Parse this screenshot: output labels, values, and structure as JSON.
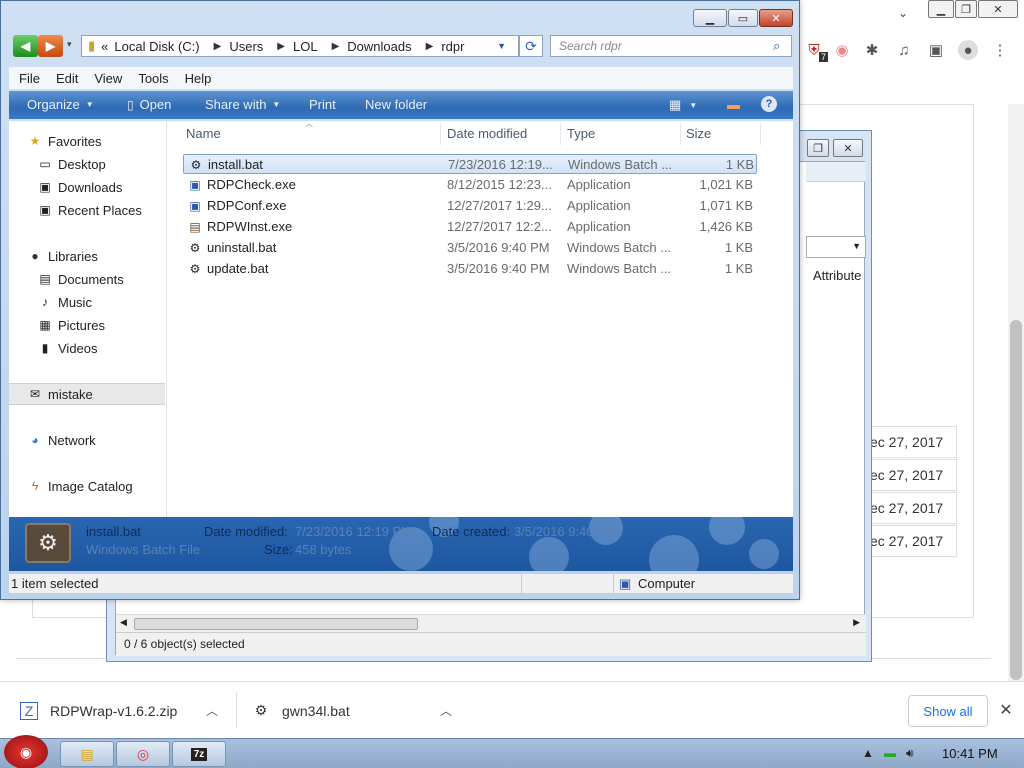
{
  "explorer": {
    "address": {
      "parts": [
        "Local Disk (C:)",
        "Users",
        "LOL",
        "Downloads",
        "rdpr"
      ],
      "overflow": "«"
    },
    "search_placeholder": "Search rdpr",
    "menu": [
      "File",
      "Edit",
      "View",
      "Tools",
      "Help"
    ],
    "commands": {
      "organize": "Organize",
      "open": "Open",
      "share_with": "Share with",
      "print": "Print",
      "new_folder": "New folder"
    },
    "nav": {
      "favorites": "Favorites",
      "desktop": "Desktop",
      "downloads": "Downloads",
      "recent_places": "Recent Places",
      "libraries": "Libraries",
      "documents": "Documents",
      "music": "Music",
      "pictures": "Pictures",
      "videos": "Videos",
      "mistake": "mistake",
      "network": "Network",
      "image_catalog": "Image Catalog"
    },
    "columns": {
      "name": "Name",
      "date": "Date modified",
      "type": "Type",
      "size": "Size"
    },
    "files": [
      {
        "name": "install.bat",
        "date": "7/23/2016 12:19...",
        "type": "Windows Batch ...",
        "size": "1 KB",
        "selected": true
      },
      {
        "name": "RDPCheck.exe",
        "date": "8/12/2015 12:23...",
        "type": "Application",
        "size": "1,021 KB"
      },
      {
        "name": "RDPConf.exe",
        "date": "12/27/2017 1:29...",
        "type": "Application",
        "size": "1,071 KB"
      },
      {
        "name": "RDPWInst.exe",
        "date": "12/27/2017 12:2...",
        "type": "Application",
        "size": "1,426 KB"
      },
      {
        "name": "uninstall.bat",
        "date": "3/5/2016 9:40 PM",
        "type": "Windows Batch ...",
        "size": "1 KB"
      },
      {
        "name": "update.bat",
        "date": "3/5/2016 9:40 PM",
        "type": "Windows Batch ...",
        "size": "1 KB"
      }
    ],
    "details": {
      "filename": "install.bat",
      "filetype": "Windows Batch File",
      "date_modified_label": "Date modified:",
      "date_modified": "7/23/2016 12:19 PM",
      "date_created_label": "Date created:",
      "date_created": "3/5/2016 9:40 PM",
      "size_label": "Size:",
      "size": "458 bytes"
    },
    "status": {
      "selection": "1 item selected",
      "location": "Computer"
    }
  },
  "back_window": {
    "column_attr": "Attribute",
    "status": "0 / 6 object(s) selected"
  },
  "browser": {
    "dates": [
      "ec 27, 2017",
      "ec 27, 2017",
      "ec 27, 2017",
      "ec 27, 2017"
    ],
    "badge": "7",
    "downloads": [
      {
        "name": "RDPWrap-v1.6.2.zip"
      },
      {
        "name": "gwn34l.bat"
      }
    ],
    "show_all": "Show all"
  },
  "taskbar": {
    "clock": "10:41 PM",
    "app_7z": "7z"
  }
}
